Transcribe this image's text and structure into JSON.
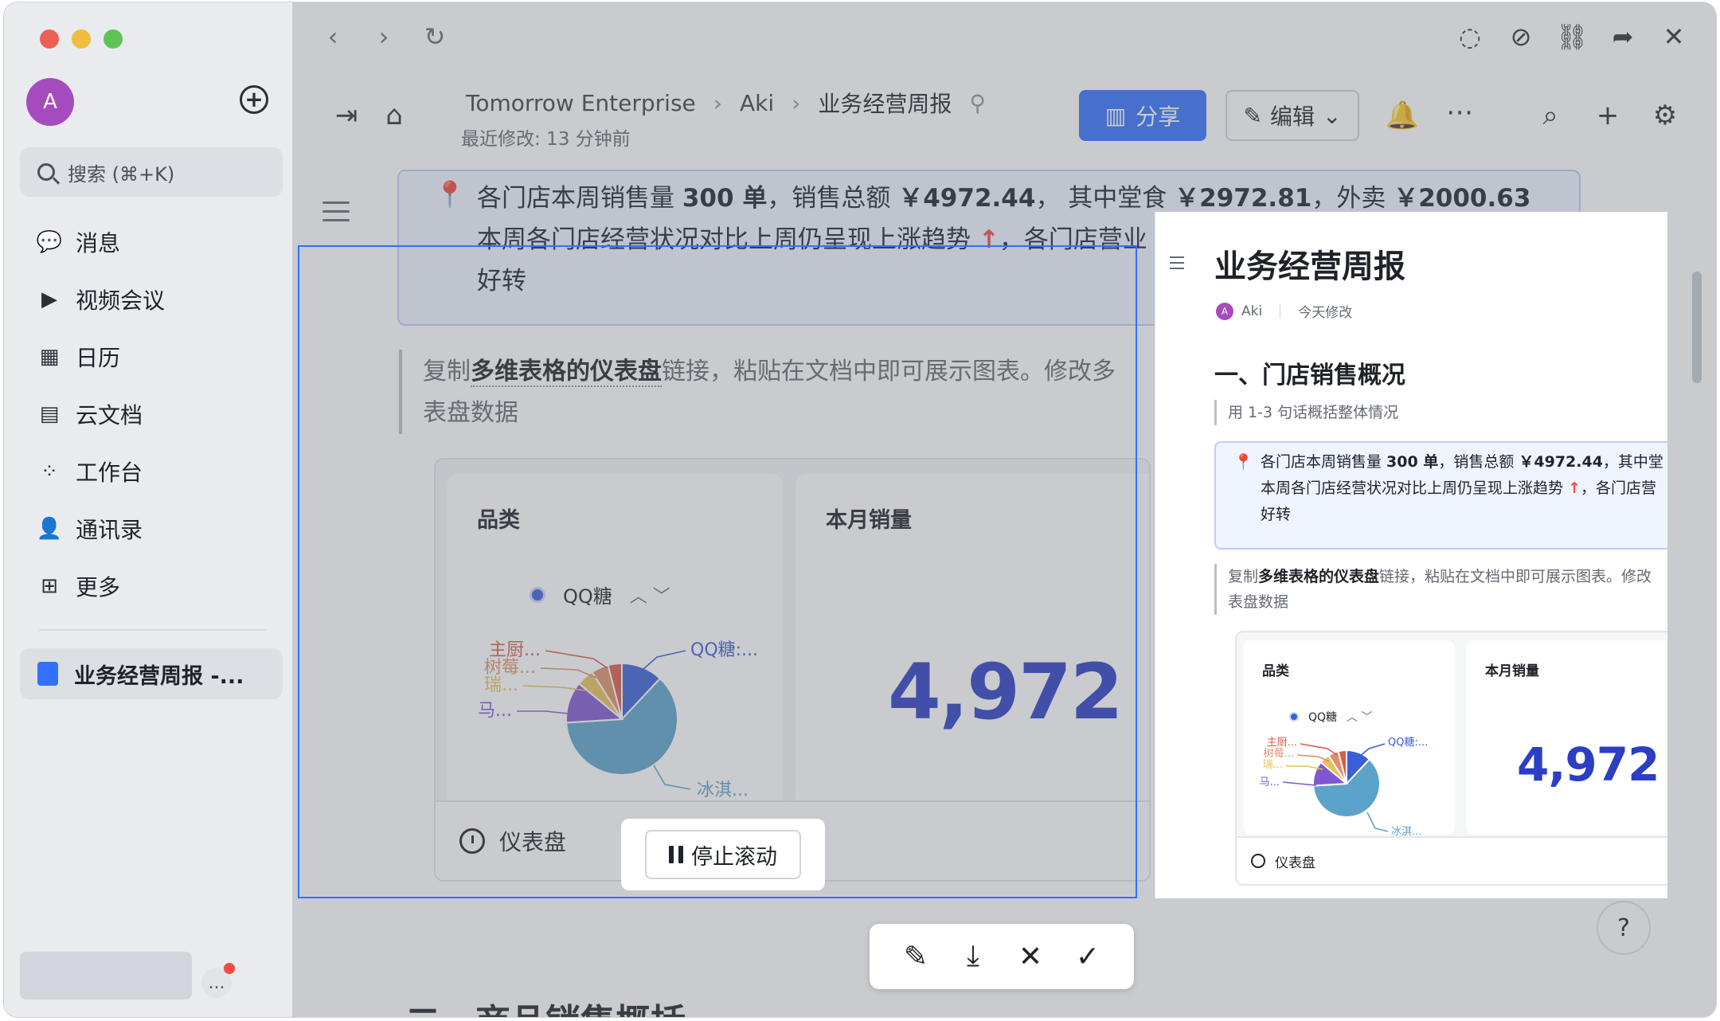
{
  "sidebar": {
    "avatar_letter": "A",
    "search_placeholder": "搜索 (⌘+K)",
    "nav": [
      {
        "label": "消息",
        "icon": "chat-icon"
      },
      {
        "label": "视频会议",
        "icon": "video-icon"
      },
      {
        "label": "日历",
        "icon": "calendar-icon"
      },
      {
        "label": "云文档",
        "icon": "cloud-doc-icon"
      },
      {
        "label": "工作台",
        "icon": "workspace-icon"
      },
      {
        "label": "通讯录",
        "icon": "contacts-icon"
      },
      {
        "label": "更多",
        "icon": "more-apps-icon"
      }
    ],
    "open_doc": "业务经营周报 -...",
    "more_label": "..."
  },
  "header": {
    "breadcrumb": [
      "Tomorrow Enterprise",
      "Aki",
      "业务经营周报"
    ],
    "modified": "最近修改: 13 分钟前",
    "share_label": "分享",
    "edit_label": "编辑"
  },
  "document": {
    "callout": {
      "line1_parts": [
        "各门店本周销售量 ",
        "300 单",
        "，销售总额 ",
        "￥4972.44",
        "， 其中堂食 ",
        "￥2972.81",
        "，外卖 ",
        "￥2000.63"
      ],
      "line2": "本周各门店经营状况对比上周仍呈现上涨趋势",
      "line2_arrow": "↑",
      "line2_tail": "，各门店营业",
      "line3": "好转"
    },
    "quote": {
      "prefix": "复制",
      "bold": "多维表格的仪表盘",
      "suffix": "链接，粘贴在文档中即可展示图表。修改多",
      "line2": "表盘数据"
    },
    "next_heading": "二、商品销售概括"
  },
  "dashboard": {
    "panel1_title": "品类",
    "legend_label": "QQ糖",
    "panel2_title": "本月销量",
    "big_number": "4,972",
    "footer_label": "仪表盘"
  },
  "chart_data": {
    "type": "pie",
    "title": "品类",
    "series": [
      {
        "name": "冰淇...",
        "value": 62,
        "color": "#5ba3c9"
      },
      {
        "name": "马...",
        "value": 12,
        "color": "#8256d0"
      },
      {
        "name": "瑞...",
        "value": 5,
        "color": "#e8c15a"
      },
      {
        "name": "树莓...",
        "value": 5,
        "color": "#e08f6a"
      },
      {
        "name": "主厨...",
        "value": 4,
        "color": "#d95b4a"
      },
      {
        "name": "QQ糖:...",
        "value": 12,
        "color": "#3c5ed7"
      }
    ],
    "labels": {
      "qq": "QQ糖:...",
      "bingqi": "冰淇...",
      "zhuchu": "主厨...",
      "shumei": "树莓...",
      "rui": "瑞...",
      "ma": "马..."
    }
  },
  "capture": {
    "stop_scroll_label": "停止滚动"
  },
  "preview": {
    "title": "业务经营周报",
    "author": "Aki",
    "author_initial": "A",
    "modified": "今天修改",
    "h1": "一、门店销售概况",
    "hint": "用 1-3 句话概括整体情况",
    "callout_line1_parts": [
      "各门店本周销售量 ",
      "300 单",
      "，销售总额 ",
      "￥4972.44",
      "，其中堂"
    ],
    "callout_line2": "本周各门店经营状况对比上周仍呈现上涨趋势",
    "callout_line2_arrow": "↑",
    "callout_line2_tail": "，各门店营",
    "callout_line3": "好转",
    "quote_prefix": "复制",
    "quote_bold": "多维表格的仪表盘",
    "quote_suffix": "链接，粘贴在文档中即可展示图表。修改",
    "quote_line2": "表盘数据",
    "panel1_title": "品类",
    "legend_label": "QQ糖",
    "panel2_title": "本月销量",
    "big_number": "4,972",
    "footer_label": "仪表盘"
  },
  "help_label": "?"
}
